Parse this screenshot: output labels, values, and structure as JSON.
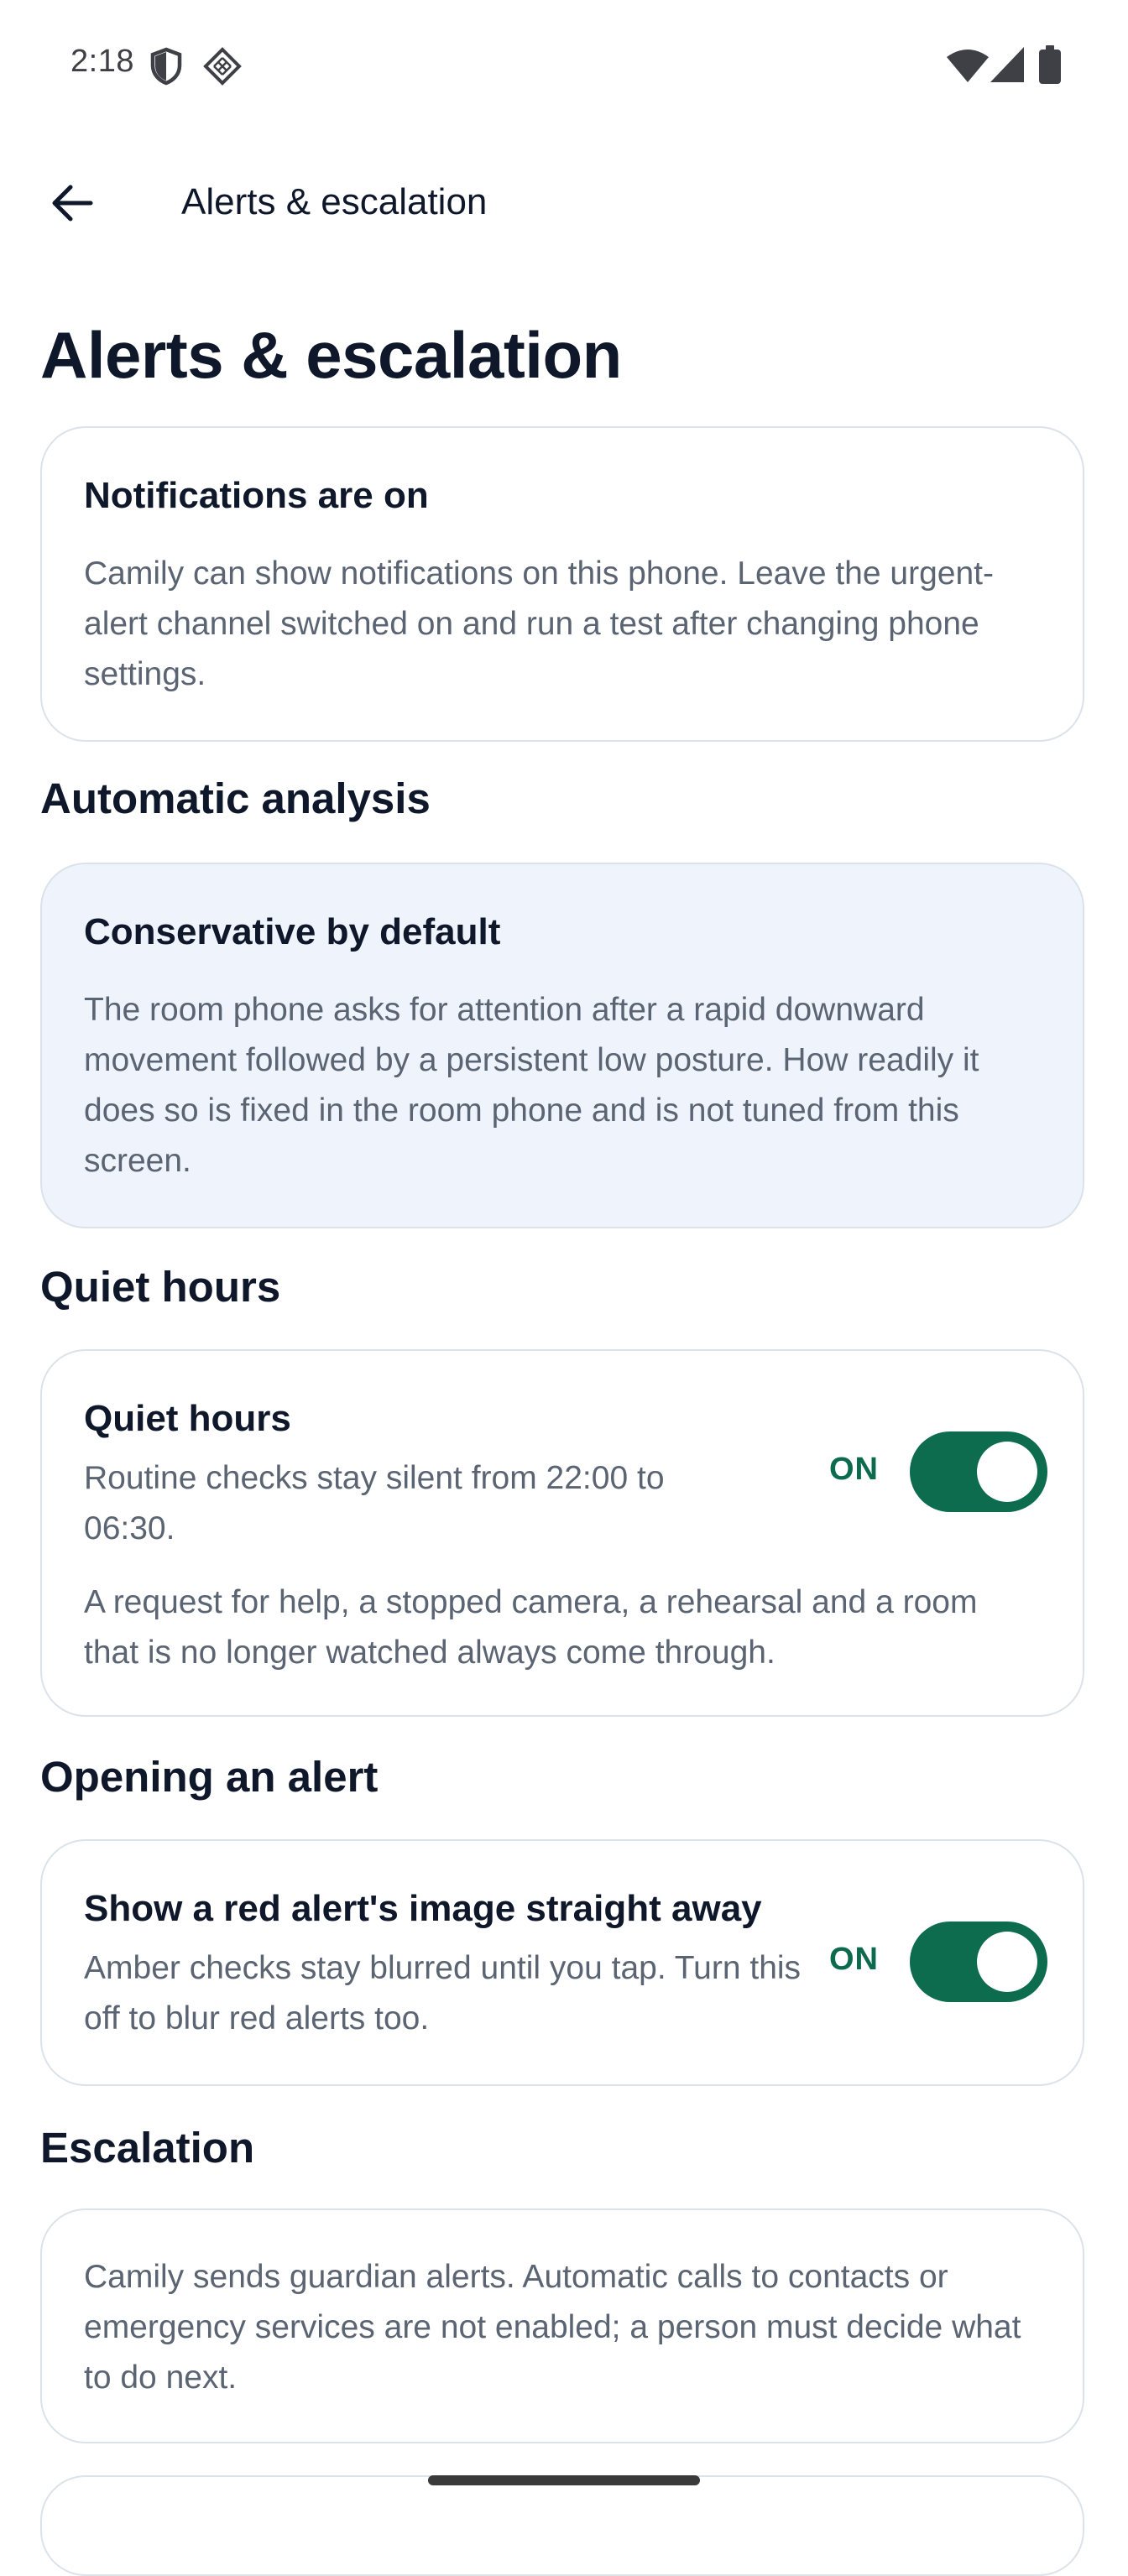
{
  "status_bar": {
    "time": "2:18",
    "icons": [
      "shield-icon",
      "diamond-grid-icon",
      "wifi-icon",
      "cellular-signal-icon",
      "battery-icon"
    ]
  },
  "app_bar": {
    "back_icon": "arrow-left-icon",
    "title": "Alerts & escalation"
  },
  "page": {
    "title": "Alerts & escalation"
  },
  "notifications_card": {
    "title": "Notifications are on",
    "body": "Camily can show notifications on this phone. Leave the urgent-alert channel switched on and run a test after changing phone settings."
  },
  "automatic_analysis": {
    "heading": "Automatic analysis",
    "card_title": "Conservative by default",
    "card_body": "The room phone asks for attention after a rapid downward movement followed by a persistent low posture. How readily it does so is fixed in the room phone and is not tuned from this screen."
  },
  "quiet_hours": {
    "heading": "Quiet hours",
    "setting_title": "Quiet hours",
    "setting_description": "Routine checks stay silent from 22:00 to 06:30.",
    "toggle_state": "ON",
    "toggle_on": true,
    "note": "A request for help, a stopped camera, a rehearsal and a room that is no longer watched always come through."
  },
  "opening_alert": {
    "heading": "Opening an alert",
    "setting_title": "Show a red alert's image straight away",
    "setting_description": "Amber checks stay blurred until you tap. Turn this off to blur red alerts too.",
    "toggle_state": "ON",
    "toggle_on": true
  },
  "escalation": {
    "heading": "Escalation",
    "body": "Camily sends guardian alerts. Automatic calls to contacts or emergency services are not enabled; a person must decide what to do next."
  },
  "colors": {
    "accent_green": "#0d6b4e",
    "card_blue": "#eef3fc",
    "card_border": "#dbe2ea",
    "text_primary": "#0f172a",
    "text_secondary": "#5b6472"
  }
}
